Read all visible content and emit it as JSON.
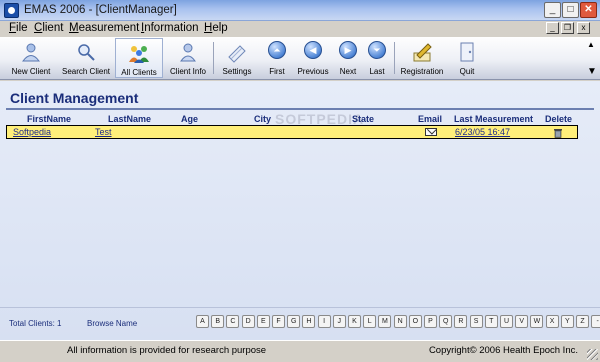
{
  "window": {
    "title": "EMAS 2006 - [ClientManager]",
    "controls": {
      "minimize": "_",
      "maximize": "□",
      "close": "✕"
    }
  },
  "menu": {
    "items": [
      "File",
      "Client",
      "Measurement",
      "Information",
      "Help"
    ],
    "mdi_controls": {
      "minimize": "_",
      "restore": "❐",
      "close": "x"
    }
  },
  "toolbar": {
    "buttons": [
      {
        "label": "New Client",
        "icon": "new-client-icon"
      },
      {
        "label": "Search Client",
        "icon": "search-client-icon"
      },
      {
        "label": "All Clients",
        "icon": "all-clients-icon",
        "active": true
      },
      {
        "label": "Client Info",
        "icon": "client-info-icon"
      },
      {
        "label": "Settings",
        "icon": "settings-icon"
      },
      {
        "label": "First",
        "icon": "first-icon",
        "glyph": "⏶"
      },
      {
        "label": "Previous",
        "icon": "previous-icon",
        "glyph": "◀"
      },
      {
        "label": "Next",
        "icon": "next-icon",
        "glyph": "▶"
      },
      {
        "label": "Last",
        "icon": "last-icon",
        "glyph": "⏷"
      },
      {
        "label": "Registration",
        "icon": "registration-icon"
      },
      {
        "label": "Quit",
        "icon": "quit-icon"
      }
    ],
    "scroll": {
      "up": "▲",
      "down": "▼"
    }
  },
  "main": {
    "title": "Client Management",
    "watermark": "SOFTPEDIA",
    "columns": {
      "first_name": "FirstName",
      "last_name": "LastName",
      "age": "Age",
      "city": "City",
      "state": "State",
      "email": "Email",
      "last_measurement": "Last Measurement",
      "delete": "Delete"
    },
    "rows": [
      {
        "first_name": "Softpedia",
        "last_name": "Test",
        "age": "",
        "city": "",
        "state": "",
        "last_measurement": "6/23/05 16:47"
      }
    ],
    "footer": {
      "total_clients": "Total Clients: 1",
      "browse_name": "Browse Name",
      "letters": [
        "A",
        "B",
        "C",
        "D",
        "E",
        "F",
        "G",
        "H",
        "I",
        "J",
        "K",
        "L",
        "M",
        "N",
        "O",
        "P",
        "Q",
        "R",
        "S",
        "T",
        "U",
        "V",
        "W",
        "X",
        "Y",
        "Z",
        "-"
      ]
    }
  },
  "status": {
    "left": "All information is provided for research purpose",
    "right": "Copyright© 2006 Health Epoch Inc."
  },
  "colors": {
    "header_text": "#1a2d7a",
    "row_highlight": "#ffef7a",
    "link": "#1e2b8a"
  }
}
